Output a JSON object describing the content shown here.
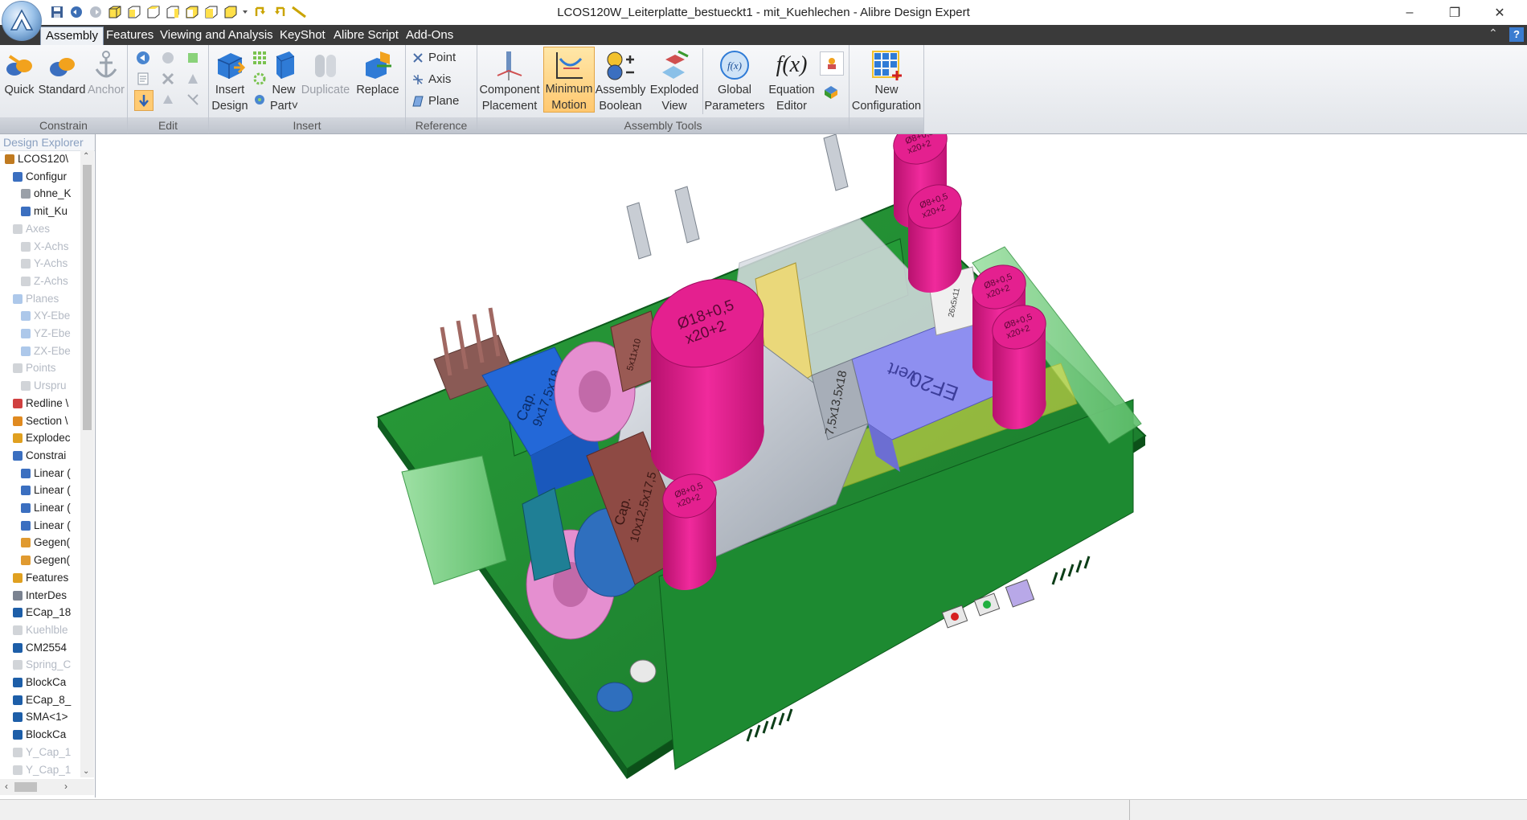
{
  "window": {
    "title": "LCOS120W_Leiterplatte_bestueckt1 - mit_Kuehlechen - Alibre Design Expert",
    "minimize_glyph": "–",
    "restore_glyph": "❐",
    "close_glyph": "✕"
  },
  "menu": {
    "tabs": [
      {
        "label": "Assembly",
        "active": true
      },
      {
        "label": "Features"
      },
      {
        "label": "Viewing and Analysis"
      },
      {
        "label": "KeyShot"
      },
      {
        "label": "Alibre Script"
      },
      {
        "label": "Add-Ons"
      }
    ],
    "collapse_glyph": "⌃",
    "help_glyph": "?"
  },
  "ribbon": {
    "constrain": {
      "label": "Constrain",
      "quick": "Quick",
      "standard": "Standard",
      "anchor": "Anchor"
    },
    "edit": {
      "label": "Edit"
    },
    "insert": {
      "label": "Insert",
      "insert_design_1": "Insert",
      "insert_design_2": "Design",
      "new_part_1": "New",
      "new_part_2": "Part˅",
      "duplicate": "Duplicate",
      "replace": "Replace"
    },
    "reference": {
      "label": "Reference",
      "point": "Point",
      "axis": "Axis",
      "plane": "Plane"
    },
    "assembly_tools": {
      "label": "Assembly Tools",
      "component_placement_1": "Component",
      "component_placement_2": "Placement",
      "minimum_motion_1": "Minimum",
      "minimum_motion_2": "Motion",
      "assembly_boolean_1": "Assembly",
      "assembly_boolean_2": "Boolean",
      "exploded_view_1": "Exploded",
      "exploded_view_2": "View",
      "global_parameters_1": "Global",
      "global_parameters_2": "Parameters",
      "equation_editor_1": "Equation",
      "equation_editor_2": "Editor",
      "fx_glyph": "f(x)"
    },
    "configuration": {
      "new_configuration_1": "New",
      "new_configuration_2": "Configuration"
    }
  },
  "explorer": {
    "title": "Design Explorer",
    "nodes": [
      {
        "label": "LCOS120\\",
        "dim": false
      },
      {
        "label": "Configur",
        "dim": false
      },
      {
        "label": "ohne_K",
        "dim": false
      },
      {
        "label": "mit_Ku",
        "dim": false
      },
      {
        "label": "Axes",
        "dim": true
      },
      {
        "label": "X-Achs",
        "dim": true
      },
      {
        "label": "Y-Achs",
        "dim": true
      },
      {
        "label": "Z-Achs",
        "dim": true
      },
      {
        "label": "Planes",
        "dim": true
      },
      {
        "label": "XY-Ebe",
        "dim": true
      },
      {
        "label": "YZ-Ebe",
        "dim": true
      },
      {
        "label": "ZX-Ebe",
        "dim": true
      },
      {
        "label": "Points",
        "dim": true
      },
      {
        "label": "Urspru",
        "dim": true
      },
      {
        "label": "Redline \\",
        "dim": false
      },
      {
        "label": "Section \\",
        "dim": false
      },
      {
        "label": "Explodec",
        "dim": false
      },
      {
        "label": "Constrai",
        "dim": false
      },
      {
        "label": "Linear (",
        "dim": false
      },
      {
        "label": "Linear (",
        "dim": false
      },
      {
        "label": "Linear (",
        "dim": false
      },
      {
        "label": "Linear (",
        "dim": false
      },
      {
        "label": "Gegen(",
        "dim": false
      },
      {
        "label": "Gegen(",
        "dim": false
      },
      {
        "label": "Features",
        "dim": false
      },
      {
        "label": "InterDes",
        "dim": false
      },
      {
        "label": "ECap_18",
        "dim": false
      },
      {
        "label": "Kuehlble",
        "dim": true
      },
      {
        "label": "CM2554",
        "dim": false
      },
      {
        "label": "Spring_C",
        "dim": true
      },
      {
        "label": "BlockCa",
        "dim": false
      },
      {
        "label": "ECap_8_",
        "dim": false
      },
      {
        "label": "SMA<1>",
        "dim": false
      },
      {
        "label": "BlockCa",
        "dim": false
      },
      {
        "label": "Y_Cap_1",
        "dim": true
      },
      {
        "label": "Y_Cap_1",
        "dim": true
      }
    ]
  },
  "model_labels": {
    "cap_big_1": "Ø18+0,5",
    "cap_big_2": "x20+2",
    "cap_s1_1": "Ø8+0,5",
    "cap_s1_2": "x20+2",
    "cap_s2_1": "Ø8+0,5",
    "cap_s2_2": "x20+2",
    "cap_s3_1": "Ø8+0,5",
    "cap_s3_2": "x20+2",
    "cap_s4_1": "Ø8+0,5",
    "cap_s4_2": "x20+2",
    "cap_s5_1": "Ø8+0,5",
    "cap_s5_2": "x20+2",
    "transformer_1": "EF20",
    "transformer_2": "vert",
    "blue_cap_1": "Cap.",
    "blue_cap_2": "9x17,5x18",
    "brown_cap_1": "Cap.",
    "brown_cap_2": "10x12,5x17,5",
    "grey_cap": "7,5x13,5x18",
    "small_brown": "5x11x10",
    "white_part": "26x5x11"
  },
  "colors": {
    "pcb_green": "#1f8a2e",
    "magenta": "#e0198a",
    "connector_green": "#7fd08a",
    "accent_orange": "#ffc870"
  }
}
